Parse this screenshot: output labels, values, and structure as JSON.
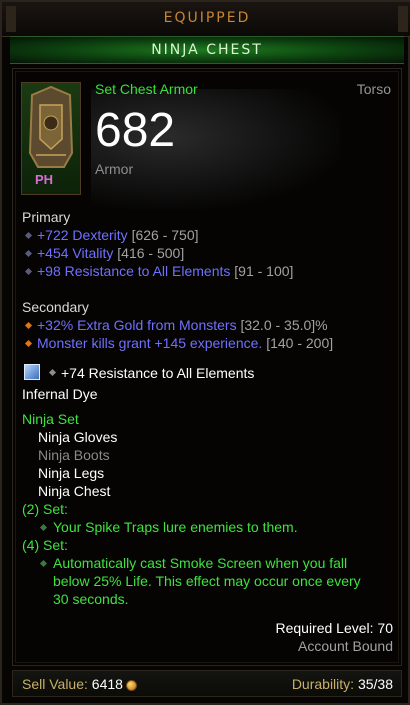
{
  "header": {
    "equipped_label": "EQUIPPED",
    "item_name": "NINJA CHEST"
  },
  "item": {
    "type": "Set Chest Armor",
    "slot": "Torso",
    "armor_value": "682",
    "armor_label": "Armor",
    "portrait_badge": "PH"
  },
  "primary": {
    "heading": "Primary",
    "stats": [
      {
        "text": "+722 Dexterity",
        "range": "[626 - 750]"
      },
      {
        "text": "+454 Vitality",
        "range": "[416 - 500]"
      },
      {
        "text": "+98 Resistance to All Elements",
        "range": "[91 - 100]"
      }
    ]
  },
  "secondary": {
    "heading": "Secondary",
    "stats": [
      {
        "text": "+32% Extra Gold from Monsters",
        "range": "[32.0 - 35.0]%"
      },
      {
        "text": "Monster kills grant +145 experience.",
        "range": "[140 - 200]"
      }
    ]
  },
  "socket": {
    "text": "+74 Resistance to All Elements",
    "icon": "gem-icon"
  },
  "dye": "Infernal Dye",
  "set": {
    "name": "Ninja Set",
    "pieces": [
      {
        "name": "Ninja Gloves",
        "equipped": true
      },
      {
        "name": "Ninja Boots",
        "equipped": false
      },
      {
        "name": "Ninja Legs",
        "equipped": true
      },
      {
        "name": "Ninja Chest",
        "equipped": true
      }
    ],
    "bonuses": [
      {
        "label": "(2) Set:",
        "lines": [
          "Your Spike Traps lure enemies to them."
        ]
      },
      {
        "label": "(4) Set:",
        "lines": [
          "Automatically cast Smoke Screen when you fall",
          "below 25% Life. This effect may occur once every",
          "30 seconds."
        ]
      }
    ]
  },
  "requirements": {
    "level": "Required Level: 70",
    "bound": "Account Bound"
  },
  "footer": {
    "sell_label": "Sell Value:",
    "sell_value": "6418",
    "durability_label": "Durability:",
    "durability_value": "35/38"
  },
  "colors": {
    "set_green": "#3fe23f",
    "magic_blue": "#7070ff",
    "legend_orange": "#c8862f"
  }
}
